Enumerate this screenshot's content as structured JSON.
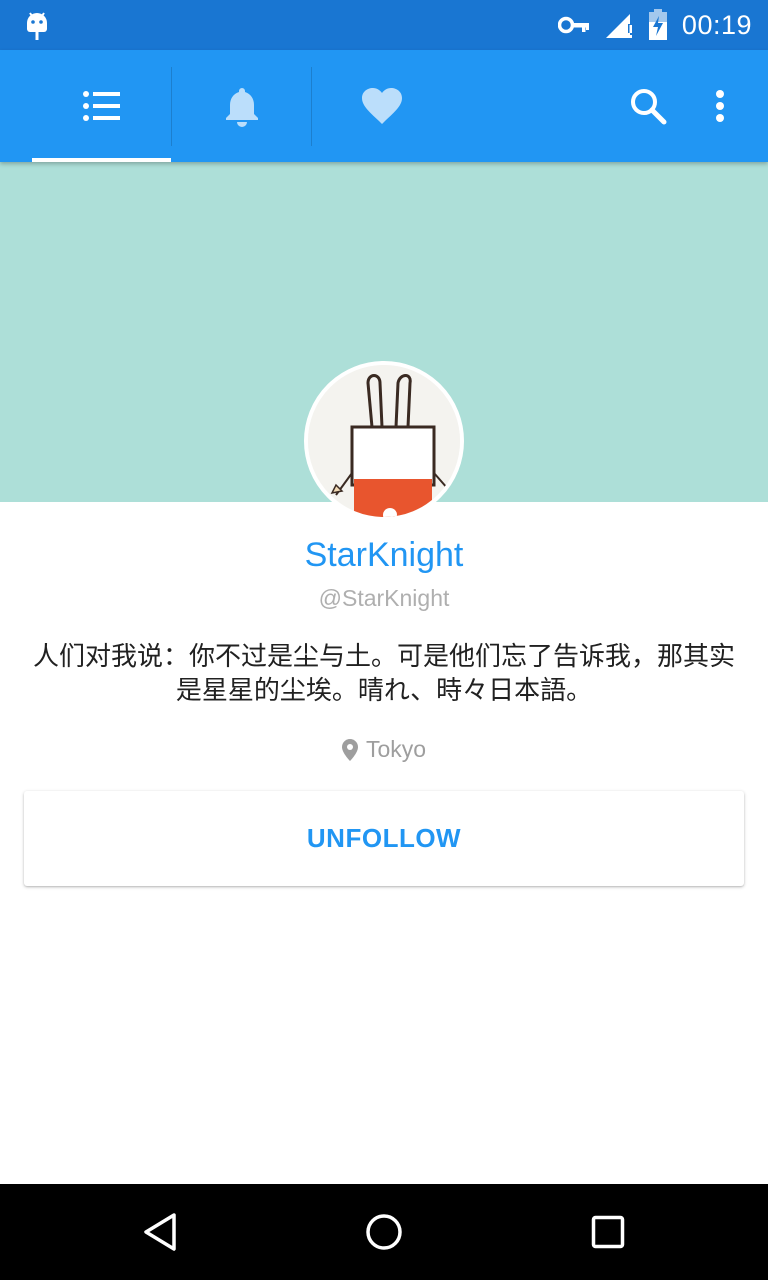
{
  "status_bar": {
    "time": "00:19",
    "icons": [
      "android-debug-icon",
      "vpn-key-icon",
      "signal-icon",
      "battery-charging-icon"
    ]
  },
  "app_bar": {
    "tabs": [
      {
        "name": "home-timeline",
        "icon": "list-icon",
        "selected": true
      },
      {
        "name": "notifications",
        "icon": "bell-icon",
        "selected": false
      },
      {
        "name": "favorites",
        "icon": "heart-icon",
        "selected": false
      }
    ],
    "actions": [
      "search-icon",
      "more-vert-icon"
    ]
  },
  "profile": {
    "display_name": "StarKnight",
    "handle": "@StarKnight",
    "bio": "人们对我说：你不过是尘与土。可是他们忘了告诉我，那其实是星星的尘埃。晴れ、時々日本語。",
    "location": "Tokyo",
    "unfollow_label": "UNFOLLOW"
  },
  "colors": {
    "status_bar": "#1976D2",
    "app_bar": "#2196F3",
    "banner": "#ADDFD8",
    "accent": "#2196F3",
    "muted_text": "#9E9E9E"
  },
  "nav_bar": [
    "back-icon",
    "home-icon",
    "recents-icon"
  ]
}
